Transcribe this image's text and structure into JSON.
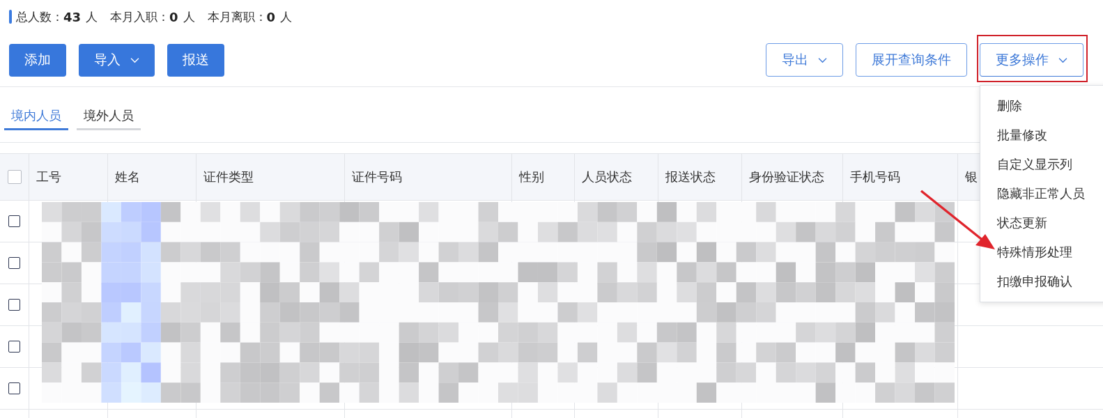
{
  "summary": [
    {
      "label": "总人数：",
      "value": "43",
      "unit": "人"
    },
    {
      "label": "本月入职：",
      "value": "0",
      "unit": "人"
    },
    {
      "label": "本月离职：",
      "value": "0",
      "unit": "人"
    }
  ],
  "primary_buttons": [
    {
      "label": "添加",
      "has_caret": false
    },
    {
      "label": "导入",
      "has_caret": true
    },
    {
      "label": "报送",
      "has_caret": false
    }
  ],
  "secondary_buttons": [
    {
      "label": "导出",
      "has_caret": true
    },
    {
      "label": "展开查询条件",
      "has_caret": false
    }
  ],
  "more_actions": {
    "label": "更多操作",
    "expanded": true,
    "highlighted": true,
    "items": [
      {
        "label": "删除",
        "pointed": false
      },
      {
        "label": "批量修改",
        "pointed": false
      },
      {
        "label": "自定义显示列",
        "pointed": false
      },
      {
        "label": "隐藏非正常人员",
        "pointed": false
      },
      {
        "label": "状态更新",
        "pointed": false
      },
      {
        "label": "特殊情形处理",
        "pointed": true
      },
      {
        "label": "扣缴申报确认",
        "pointed": false
      }
    ]
  },
  "tabs": [
    {
      "label": "境内人员",
      "selected": true
    },
    {
      "label": "境外人员",
      "selected": false
    }
  ],
  "table": {
    "select_all": {
      "checked": false
    },
    "columns": [
      "工号",
      "姓名",
      "证件类型",
      "证件号码",
      "性别",
      "人员状态",
      "报送状态",
      "身份验证状态",
      "手机号码",
      "银"
    ],
    "rows": [
      {
        "checked": false
      },
      {
        "checked": false
      },
      {
        "checked": false
      },
      {
        "checked": false
      },
      {
        "checked": false
      }
    ],
    "obscured": true
  }
}
